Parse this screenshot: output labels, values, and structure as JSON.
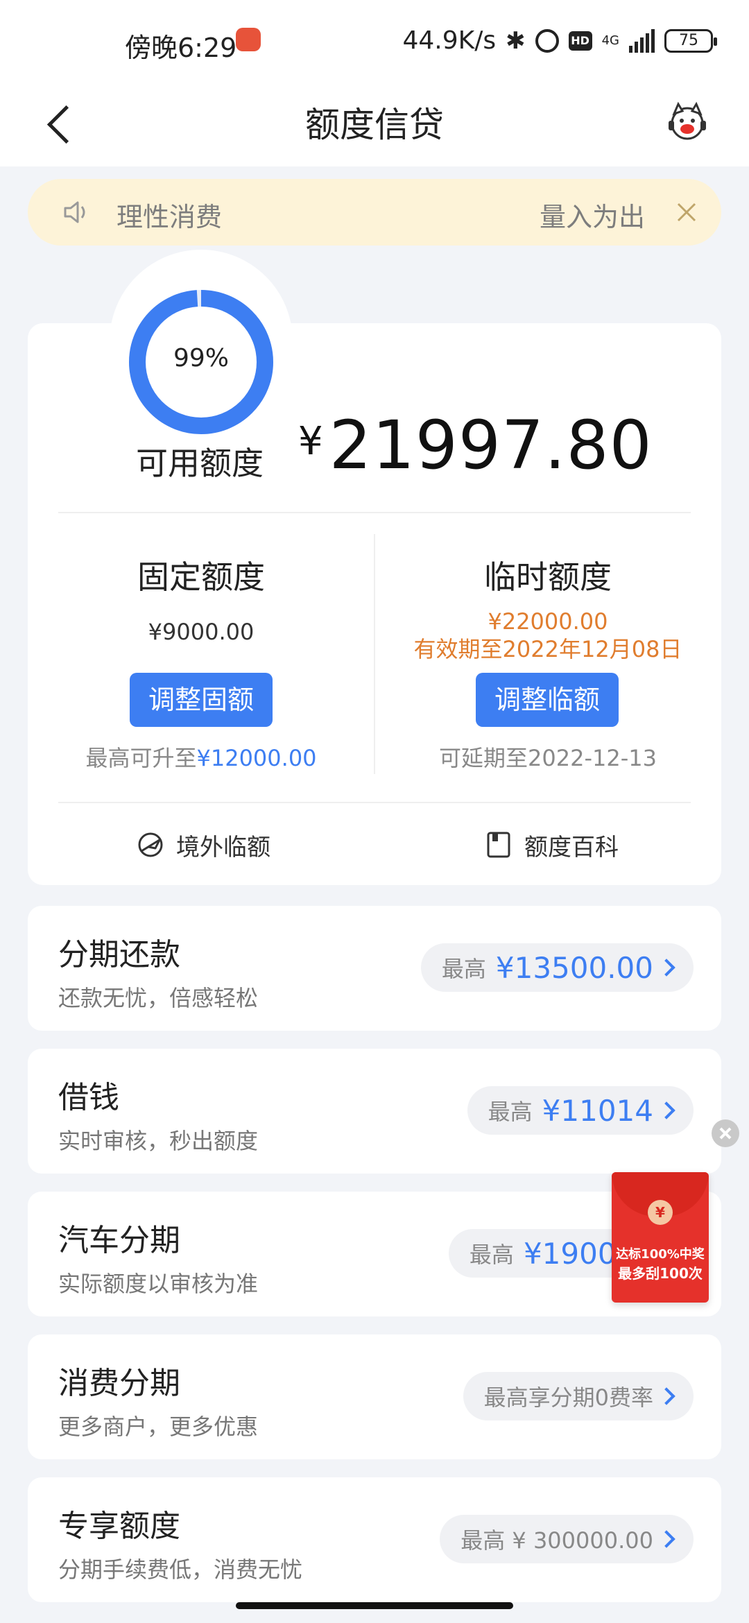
{
  "status_bar": {
    "time": "傍晚6:29",
    "net_speed": "44.9K/s",
    "network": "4G",
    "battery": "75"
  },
  "nav": {
    "title": "额度信贷"
  },
  "notice": {
    "text_left": "理性消费",
    "text_right": "量入为出"
  },
  "credit": {
    "ring_percent": "99%",
    "ring_fraction": 0.99,
    "available_label": "可用额度",
    "currency": "¥",
    "available_amount": "21997.80",
    "fixed": {
      "title": "固定额度",
      "amount": "¥9000.00",
      "button": "调整固额",
      "sub_prefix": "最高可升至",
      "sub_value": "¥12000.00"
    },
    "temp": {
      "title": "临时额度",
      "amount": "¥22000.00",
      "validity": "有效期至2022年12月08日",
      "button": "调整临额",
      "sub": "可延期至2022-12-13"
    },
    "links": {
      "overseas": "境外临额",
      "wiki": "额度百科"
    }
  },
  "products": [
    {
      "title": "分期还款",
      "sub": "还款无忧，倍感轻松",
      "prefix": "最高",
      "value": "¥13500.00"
    },
    {
      "title": "借钱",
      "sub": "实时审核，秒出额度",
      "prefix": "最高",
      "value": "¥11014"
    },
    {
      "title": "汽车分期",
      "sub": "实际额度以审核为准",
      "prefix": "最高",
      "value": "¥190000"
    },
    {
      "title": "消费分期",
      "sub": "更多商户，更多优惠",
      "prefix": "",
      "value": "最高享分期0费率"
    },
    {
      "title": "专享额度",
      "sub": "分期手续费低，消费无忧",
      "prefix": "",
      "value": "最高 ¥ 300000.00"
    }
  ],
  "redpack": {
    "coin": "¥",
    "line1": "达标100%中奖",
    "line2": "最多刮100次"
  },
  "colors": {
    "accent": "#3d7ef2",
    "temp_orange": "#e07d2e",
    "notice_bg": "#fdf3d8",
    "page_bg": "#f2f4f8",
    "redpack": "#e5312b"
  }
}
